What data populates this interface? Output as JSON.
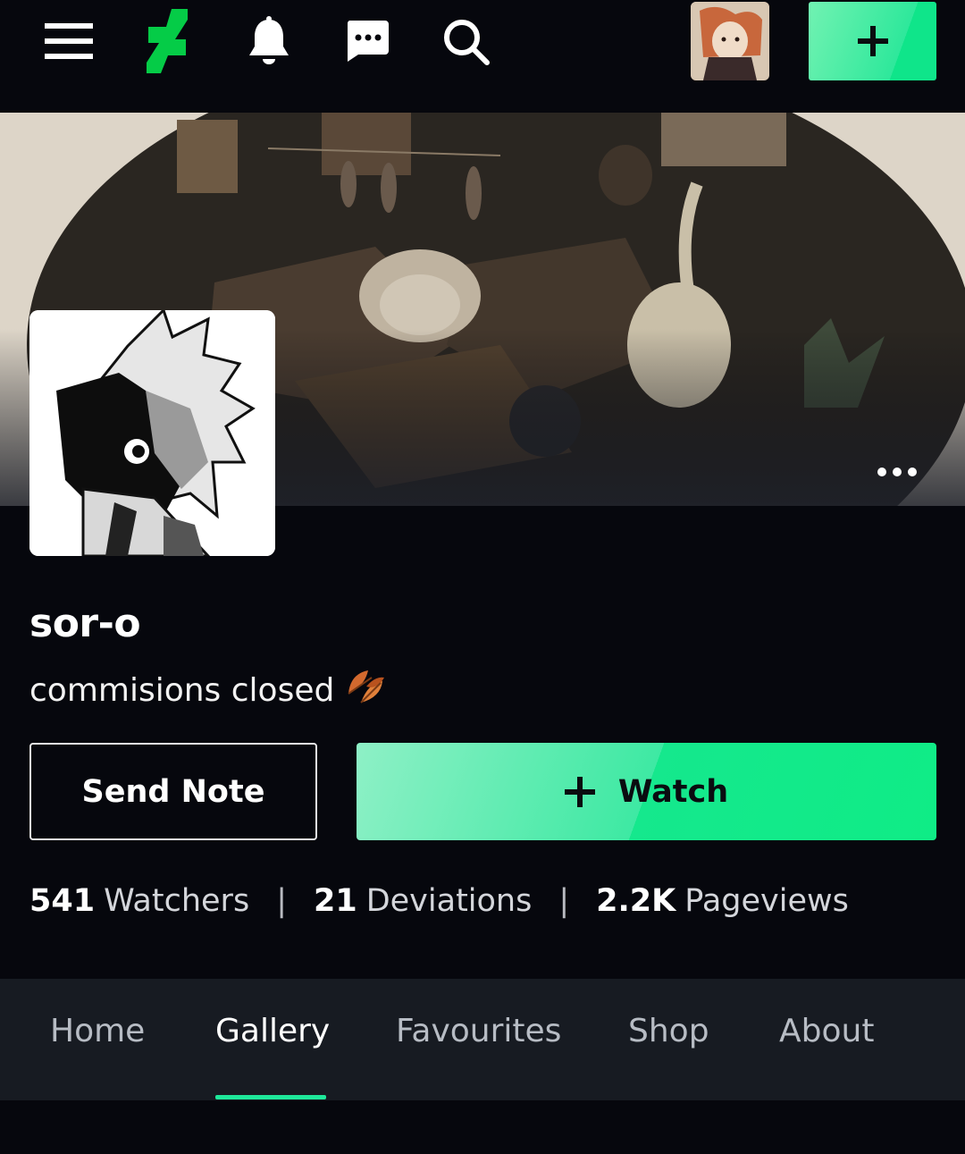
{
  "topbar": {
    "icons": [
      "menu-icon",
      "deviantart-logo",
      "bell-icon",
      "chat-icon",
      "search-icon"
    ],
    "submit_label": "+"
  },
  "profile": {
    "username": "sor-o",
    "tagline": "commisions closed",
    "tagline_emoji": "🍂"
  },
  "actions": {
    "send_note_label": "Send Note",
    "watch_icon": "+",
    "watch_label": "Watch"
  },
  "stats": {
    "watchers_count": "541",
    "watchers_label": "Watchers",
    "deviations_count": "21",
    "deviations_label": "Deviations",
    "pageviews_count": "2.2K",
    "pageviews_label": "Pageviews",
    "separator": "|"
  },
  "tabs": [
    {
      "label": "Home",
      "active": false
    },
    {
      "label": "Gallery",
      "active": true
    },
    {
      "label": "Favourites",
      "active": false
    },
    {
      "label": "Shop",
      "active": false
    },
    {
      "label": "About",
      "active": false
    }
  ],
  "colors": {
    "accent": "#1ee89a",
    "background": "#06070d",
    "tabs_background": "#171b22"
  }
}
